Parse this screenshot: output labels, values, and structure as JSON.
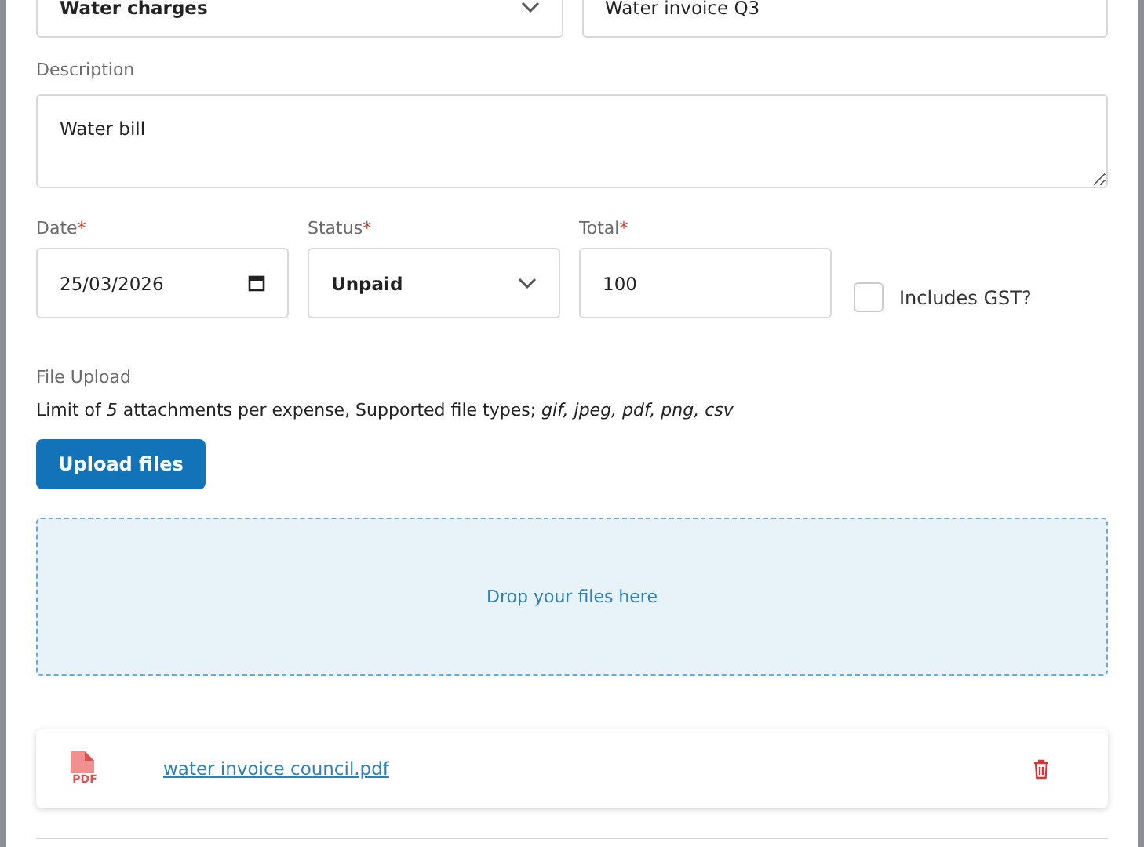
{
  "top_row": {
    "category": {
      "value": "Water charges"
    },
    "reference": {
      "value": "Water invoice Q3"
    }
  },
  "description": {
    "label": "Description",
    "value": "Water bill"
  },
  "date": {
    "label": "Date",
    "required_mark": "*",
    "value": "25/03/2026"
  },
  "status": {
    "label": "Status",
    "required_mark": "*",
    "value": "Unpaid"
  },
  "total": {
    "label": "Total",
    "required_mark": "*",
    "value": "100"
  },
  "includes_gst": {
    "label": "Includes GST?",
    "checked": false
  },
  "file_upload": {
    "label": "File Upload",
    "hint": "Limit of *5* attachments per expense, Supported file types; *gif, jpeg, pdf, png, csv*",
    "button": "Upload files",
    "dropzone": "Drop your files here",
    "files": [
      {
        "name": "water invoice council.pdf",
        "icon_label": "PDF"
      }
    ]
  }
}
